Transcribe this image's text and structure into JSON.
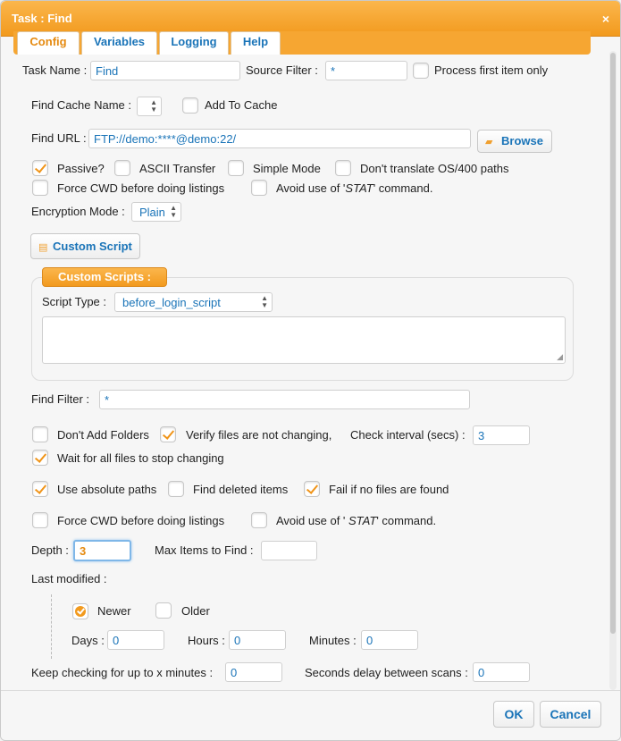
{
  "window": {
    "title": "Task : Find",
    "close_label": "×"
  },
  "tabs": [
    {
      "label": "Config",
      "active": true
    },
    {
      "label": "Variables",
      "active": false
    },
    {
      "label": "Logging",
      "active": false
    },
    {
      "label": "Help",
      "active": false
    }
  ],
  "form": {
    "task_name_label": "Task Name :",
    "task_name_value": "Find",
    "source_filter_label": "Source Filter :",
    "source_filter_value": "*",
    "process_first_label": "Process first item only",
    "process_first_checked": false,
    "find_cache_label": "Find Cache Name :",
    "add_to_cache_label": "Add To Cache",
    "add_to_cache_checked": false,
    "find_url_label": "Find URL :",
    "find_url_value": "FTP://demo:****@demo:22/",
    "browse_label": "Browse",
    "passive_label": "Passive?",
    "passive_checked": true,
    "ascii_label": "ASCII Transfer",
    "ascii_checked": false,
    "simple_mode_label": "Simple Mode",
    "simple_mode_checked": false,
    "dont_translate_label": "Don't translate OS/400 paths",
    "dont_translate_checked": false,
    "force_cwd_label": "Force CWD before doing listings",
    "force_cwd_checked": false,
    "avoid_stat_pre": "Avoid use of '",
    "avoid_stat_cmd": "STAT",
    "avoid_stat_post": "' command.",
    "avoid_stat_checked": false,
    "encryption_label": "Encryption Mode :",
    "encryption_value": "Plain",
    "custom_script_btn": "Custom Script",
    "custom_scripts_legend": "Custom Scripts :",
    "script_type_label": "Script Type :",
    "script_type_value": "before_login_script",
    "find_filter_label": "Find Filter :",
    "find_filter_value": "*",
    "dont_add_folders_label": "Don't Add Folders",
    "dont_add_folders_checked": false,
    "verify_files_label": "Verify files are not changing,",
    "verify_files_checked": true,
    "check_interval_label": "Check interval (secs) :",
    "check_interval_value": "3",
    "wait_all_label": "Wait for all files to stop changing",
    "wait_all_checked": true,
    "absolute_paths_label": "Use absolute paths",
    "absolute_paths_checked": true,
    "find_deleted_label": "Find deleted items",
    "find_deleted_checked": false,
    "fail_no_files_label": "Fail if no files are found",
    "fail_no_files_checked": true,
    "force_cwd2_label": "Force CWD before doing listings",
    "force_cwd2_checked": false,
    "avoid_stat2_pre": "Avoid use of ' ",
    "avoid_stat2_cmd": "STAT",
    "avoid_stat2_post": "' command.",
    "avoid_stat2_checked": false,
    "depth_label": "Depth :",
    "depth_value": "3",
    "max_items_label": "Max Items to Find :",
    "max_items_value": "",
    "last_modified_label": "Last modified :",
    "newer_label": "Newer",
    "newer_selected": true,
    "older_label": "Older",
    "older_selected": false,
    "days_label": "Days :",
    "days_value": "0",
    "hours_label": "Hours :",
    "hours_value": "0",
    "minutes_label": "Minutes :",
    "minutes_value": "0",
    "keep_checking_label": "Keep checking for up to x minutes :",
    "keep_checking_value": "0",
    "seconds_delay_label": "Seconds delay between scans :",
    "seconds_delay_value": "0"
  },
  "footer": {
    "ok_label": "OK",
    "cancel_label": "Cancel"
  },
  "icons": {
    "select_arrows": "updown-arrows-icon",
    "browse": "folder-open-icon",
    "custom_script": "script-icon",
    "close": "close-icon"
  },
  "colors": {
    "accent": "#f29a1e",
    "link": "#1a74b8",
    "check": "#f09418"
  }
}
